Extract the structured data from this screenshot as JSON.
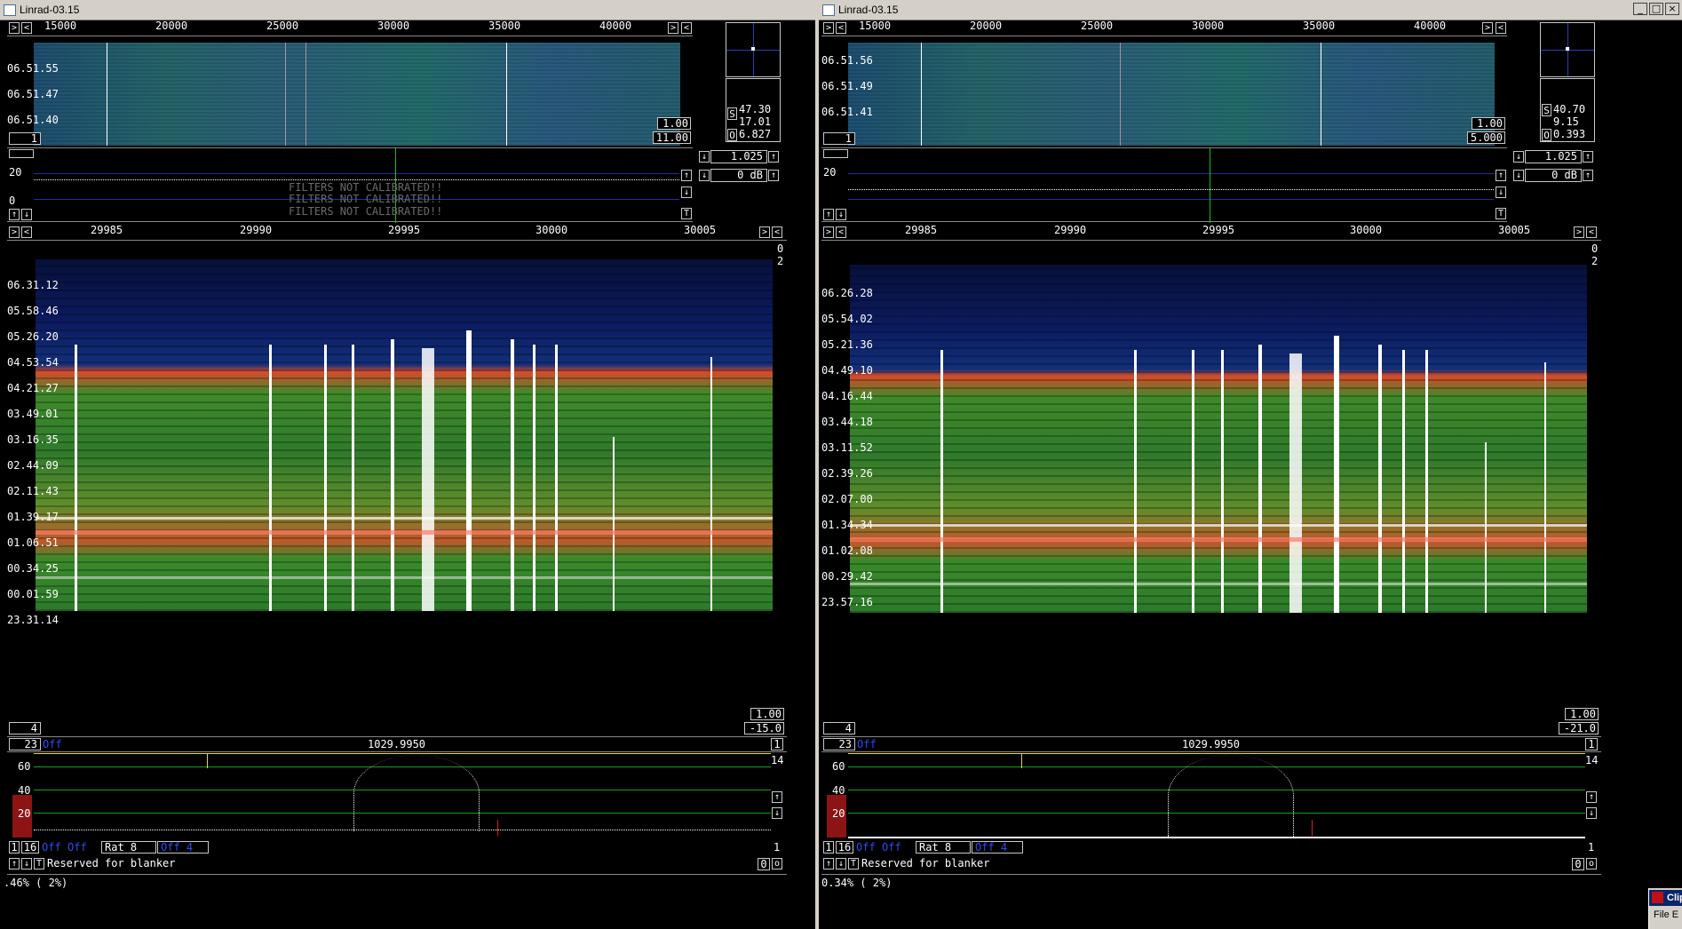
{
  "windows": [
    {
      "title": "Linrad-03.15",
      "controls": {
        "minimize": "_",
        "maximize": "□",
        "close": "×"
      },
      "wide_axis": [
        "15000",
        "20000",
        "25000",
        "30000",
        "35000",
        "40000"
      ],
      "wide_times": [
        "06.51.55",
        "06.51.47",
        "06.51.40"
      ],
      "wide_boxes": {
        "top": "1.00",
        "bottom": "11.00",
        "left": "1"
      },
      "smeter": {
        "s": "47.30",
        "v1": "17.01",
        "v2": "6.827",
        "label_s": "S",
        "label_o": "O"
      },
      "spectrum": {
        "level20": "20",
        "level0": "0",
        "ratio": "1.025",
        "db": "0 dB",
        "warning": "FILTERS NOT CALIBRATED!!",
        "t": "T"
      },
      "zoom_axis": [
        "29985",
        "29990",
        "29995",
        "30000",
        "30005"
      ],
      "zoom_right": {
        "top": "0",
        "second": "2"
      },
      "zoom_times": [
        "06.31.12",
        "05.58.46",
        "05.26.20",
        "04.53.54",
        "04.21.27",
        "03.49.01",
        "03.16.35",
        "02.44.09",
        "02.11.43",
        "01.39.17",
        "01.06.51",
        "00.34.25",
        "00.01.59",
        "23.31.14"
      ],
      "zoom_boxes": {
        "left": "4",
        "r1": "1.00",
        "r2": "-15.0"
      },
      "base": {
        "left_num": "23",
        "off": "Off",
        "freq": "1029.9950",
        "right": "1",
        "levels": [
          "60",
          "40",
          "20"
        ],
        "top_right": "14"
      },
      "bottom_row": {
        "a": "1",
        "b": "16",
        "off1": "Off",
        "off2": "Off",
        "rat": "Rat  8",
        "offs": "Off  4",
        "end": "1"
      },
      "blanker": {
        "t": "T",
        "label": "Reserved for blanker",
        "val": "0"
      },
      "status": ".46%  ( 2%)"
    },
    {
      "title": "Linrad-03.15",
      "controls": {
        "minimize": "_",
        "maximize": "□",
        "close": "×"
      },
      "wide_axis": [
        "15000",
        "20000",
        "25000",
        "30000",
        "35000",
        "40000"
      ],
      "wide_times": [
        "06.51.56",
        "06.51.49",
        "06.51.41"
      ],
      "wide_boxes": {
        "top": "1.00",
        "bottom": "5.000",
        "left": "1"
      },
      "smeter": {
        "s": "40.70",
        "v1": "9.15",
        "v2": "0.393",
        "label_s": "S",
        "label_o": "O"
      },
      "spectrum": {
        "level20": "20",
        "level0": "",
        "ratio": "1.025",
        "db": "0 dB",
        "warning": "",
        "t": "T"
      },
      "zoom_axis": [
        "29985",
        "29990",
        "29995",
        "30000",
        "30005"
      ],
      "zoom_right": {
        "top": "0",
        "second": "2"
      },
      "zoom_times": [
        "06.26.28",
        "05.54.02",
        "05.21.36",
        "04.49.10",
        "04.16.44",
        "03.44.18",
        "03.11.52",
        "02.39.26",
        "02.07.00",
        "01.34.34",
        "01.02.08",
        "00.29.42",
        "23.57.16"
      ],
      "zoom_boxes": {
        "left": "4",
        "r1": "1.00",
        "r2": "-21.0"
      },
      "base": {
        "left_num": "23",
        "off": "Off",
        "freq": "1029.9950",
        "right": "1",
        "levels": [
          "60",
          "40",
          "20"
        ],
        "top_right": "14"
      },
      "bottom_row": {
        "a": "1",
        "b": "16",
        "off1": "Off",
        "off2": "Off",
        "rat": "Rat  8",
        "offs": "Off  4",
        "end": "1"
      },
      "blanker": {
        "t": "T",
        "label": "Reserved for blanker",
        "val": "0"
      },
      "status": "0.34%  ( 2%)"
    }
  ],
  "clipboard": {
    "title": "Clip",
    "menu": "File  E"
  }
}
